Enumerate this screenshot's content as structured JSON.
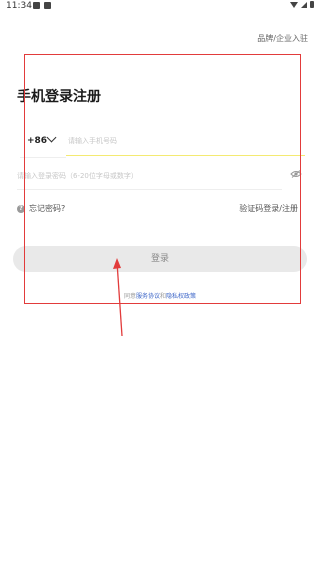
{
  "status_bar": {
    "time": "11:34",
    "left_icons": [
      "image-icon",
      "notification-icon"
    ],
    "right_icons": [
      "wifi-icon",
      "signal-icon",
      "battery-icon"
    ]
  },
  "header": {
    "brand_link": "品牌/企业入驻"
  },
  "title": "手机登录注册",
  "phone": {
    "country_code": "+86",
    "placeholder": "请输入手机号码"
  },
  "password": {
    "placeholder": "请输入登录密码（6-20位字母或数字）",
    "toggle_icon": "eye-off-icon"
  },
  "links": {
    "forgot": "忘记密码?",
    "sms_login": "验证码登录/注册"
  },
  "login_button": "登录",
  "agreement": {
    "prefix": "同意",
    "service": "服务协议",
    "conj": "和",
    "privacy": "隐私权政策"
  },
  "annotation": {
    "box_color": "#e23b3b",
    "arrow_color": "#e23b3b"
  },
  "colors": {
    "input_underline_active": "#f4ea72",
    "link": "#3d66c8",
    "button_bg": "#e9e9e9"
  }
}
